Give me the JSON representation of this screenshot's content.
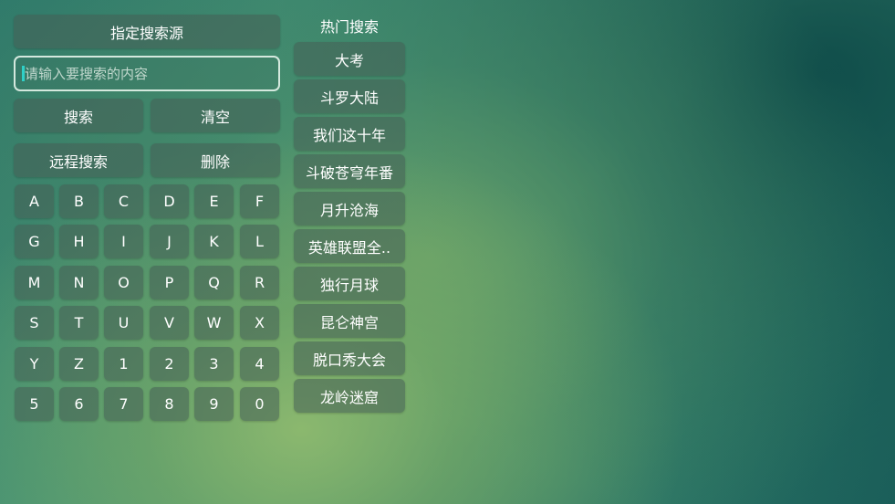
{
  "buttons": {
    "source": "指定搜索源",
    "search": "搜索",
    "clear": "清空",
    "remote": "远程搜索",
    "delete": "删除"
  },
  "search": {
    "placeholder": "请输入要搜索的内容",
    "value": ""
  },
  "keyboard": [
    [
      "A",
      "B",
      "C",
      "D",
      "E",
      "F"
    ],
    [
      "G",
      "H",
      "I",
      "J",
      "K",
      "L"
    ],
    [
      "M",
      "N",
      "O",
      "P",
      "Q",
      "R"
    ],
    [
      "S",
      "T",
      "U",
      "V",
      "W",
      "X"
    ],
    [
      "Y",
      "Z",
      "1",
      "2",
      "3",
      "4"
    ],
    [
      "5",
      "6",
      "7",
      "8",
      "9",
      "0"
    ]
  ],
  "hot": {
    "title": "热门搜索",
    "items": [
      "大考",
      "斗罗大陆",
      "我们这十年",
      "斗破苍穹年番",
      "月升沧海",
      "英雄联盟全..",
      "独行月球",
      "昆仑神宫",
      "脱口秀大会",
      "龙岭迷窟"
    ]
  },
  "colors": {
    "caret": "#2fd0c8"
  }
}
